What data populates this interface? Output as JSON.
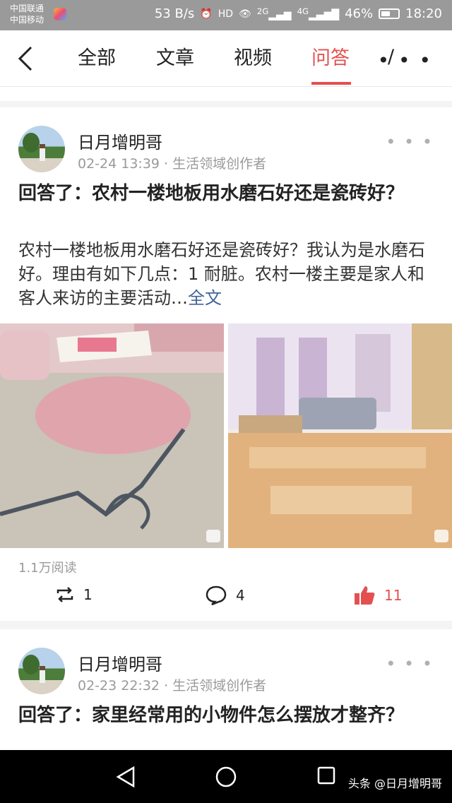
{
  "status": {
    "carrier1": "中国联通",
    "carrier2": "中国移动",
    "speed": "53 B/s",
    "signal1": "2G",
    "signal2": "4G",
    "battery": "46%",
    "time": "18:20"
  },
  "nav": {
    "tabs": [
      "全部",
      "文章",
      "视频",
      "问答"
    ],
    "active_tab": "问答",
    "more": "• • •"
  },
  "posts": [
    {
      "author": "日月增明哥",
      "meta": "02-24 13:39 · 生活领域创作者",
      "title": "回答了：农村一楼地板用水磨石好还是瓷砖好？",
      "excerpt": "农村一楼地板用水磨石好还是瓷砖好？我认为是水磨石好。理由有如下几点：1 耐脏。农村一楼主要是家人和客人来访的主要活动…",
      "fulltext": "全文",
      "reads": "1.1万阅读",
      "reposts": "1",
      "comments": "4",
      "likes": "11"
    },
    {
      "author": "日月增明哥",
      "meta": "02-23 22:32 · 生活领域创作者",
      "title": "回答了：家里经常用的小物件怎么摆放才整齐？"
    }
  ],
  "watermark": "头条 @日月增明哥",
  "colors": {
    "accent": "#e45050",
    "link": "#406599",
    "status_bar": "#9a9a9a"
  }
}
